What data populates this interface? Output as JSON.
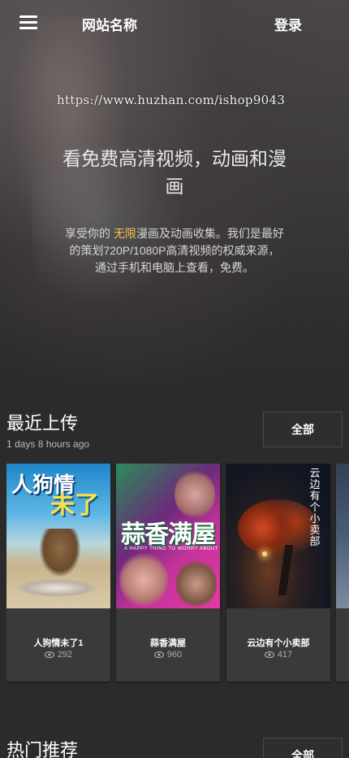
{
  "header": {
    "site_name": "网站名称",
    "login_label": "登录"
  },
  "hero": {
    "watermark": "https://www.huzhan.com/ishop9043",
    "title_line1": "看免费高清视频，动画和漫",
    "title_line2": "画",
    "desc_pre": "享受你的 ",
    "desc_highlight": "无限",
    "desc_line1_post": "漫画及动画收集。我们是最好",
    "desc_line2": "的策划720P/1080P高清视频的权威来源，",
    "desc_line3": "通过手机和电脑上查看，免费。"
  },
  "recent": {
    "title": "最近上传",
    "subtitle": "1 days 8 hours ago",
    "all_label": "全部",
    "items": [
      {
        "title": "人狗情未了1",
        "views": "292",
        "poster_text": "人狗情",
        "poster_text2": "未了"
      },
      {
        "title": "蒜香满屋",
        "views": "960",
        "poster_text": "蒜香满屋",
        "poster_text2": "A HAPPY THING TO WORRY ABOUT"
      },
      {
        "title": "云边有个小卖部",
        "views": "417",
        "poster_text": "云边有个小卖部"
      }
    ]
  },
  "popular": {
    "title": "热门推荐",
    "all_label": "全部"
  },
  "icons": {
    "menu": "hamburger-icon",
    "views": "eye-icon"
  },
  "colors": {
    "background": "#2b2b2b",
    "card": "#3a3a3a",
    "highlight": "#f0c24a"
  }
}
